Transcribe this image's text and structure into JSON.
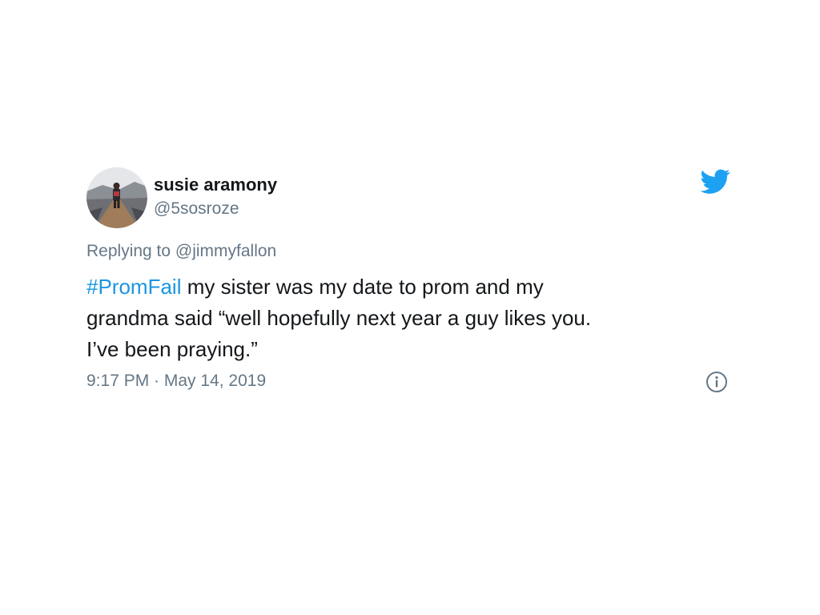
{
  "tweet": {
    "author": {
      "name": "susie aramony",
      "handle": "@5sosroze",
      "avatar_icon": "profile-photo"
    },
    "platform_icon": "twitter-bird-icon",
    "reply_context": "Replying to @jimmyfallon",
    "text": {
      "hashtag": "#PromFail",
      "line1_rest": " my sister was my date to prom and my",
      "line2": "grandma said “well hopefully next year a guy likes you.",
      "line3": "I’ve been praying.”"
    },
    "timestamp": "9:17 PM · May 14, 2019",
    "info_icon": "info-icon"
  },
  "colors": {
    "hashtag": "#1b95e0",
    "secondary_text": "#657786",
    "twitter_blue": "#1da1f2",
    "primary_text": "#14171a"
  }
}
